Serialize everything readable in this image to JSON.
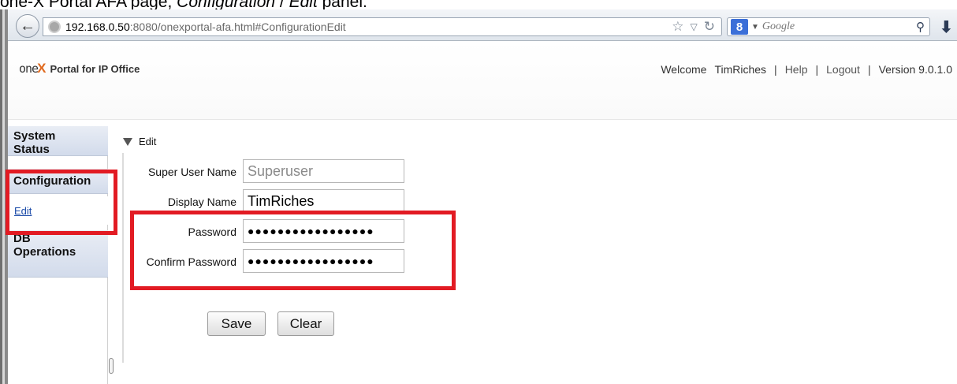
{
  "caption": {
    "prefix": "one-X Portal AFA page, ",
    "italic1": "Configuration",
    "middle": " / ",
    "italic2": "Edit",
    "suffix": " panel."
  },
  "browser": {
    "url_host": "192.168.0.50",
    "url_rest": ":8080/onexportal-afa.html#ConfigurationEdit",
    "search_engine_letter": "8",
    "search_placeholder": "Google",
    "icons": [
      "back-arrow-icon",
      "globe-icon",
      "star-icon",
      "dropdown-arrow-icon",
      "reload-icon",
      "google-icon",
      "search-icon",
      "download-icon"
    ]
  },
  "header": {
    "logo_mark": "one",
    "logo_x": "X",
    "logo_text": "Portal for IP Office",
    "welcome": "Welcome",
    "user": "TimRiches",
    "help": "Help",
    "logout": "Logout",
    "version": "Version 9.0.1.0",
    "sep": "|"
  },
  "sidebar": {
    "items": [
      {
        "label": "System Status"
      },
      {
        "label": "Configuration"
      },
      {
        "label": "DB Operations"
      }
    ],
    "sub_edit": "Edit"
  },
  "section": {
    "title": "Edit"
  },
  "form": {
    "super_user_label": "Super User Name",
    "super_user_value": "Superuser",
    "display_name_label": "Display Name",
    "display_name_value": "TimRiches",
    "password_label": "Password",
    "password_value": "●●●●●●●●●●●●●●●●●",
    "confirm_label": "Confirm Password",
    "confirm_value": "●●●●●●●●●●●●●●●●●"
  },
  "buttons": {
    "save": "Save",
    "clear": "Clear"
  },
  "colors": {
    "highlight": "#e21b23",
    "sidebar_gradient_top": "#e9edf5",
    "sidebar_gradient_bottom": "#d2dbeb",
    "logo_accent": "#e06a1f"
  }
}
